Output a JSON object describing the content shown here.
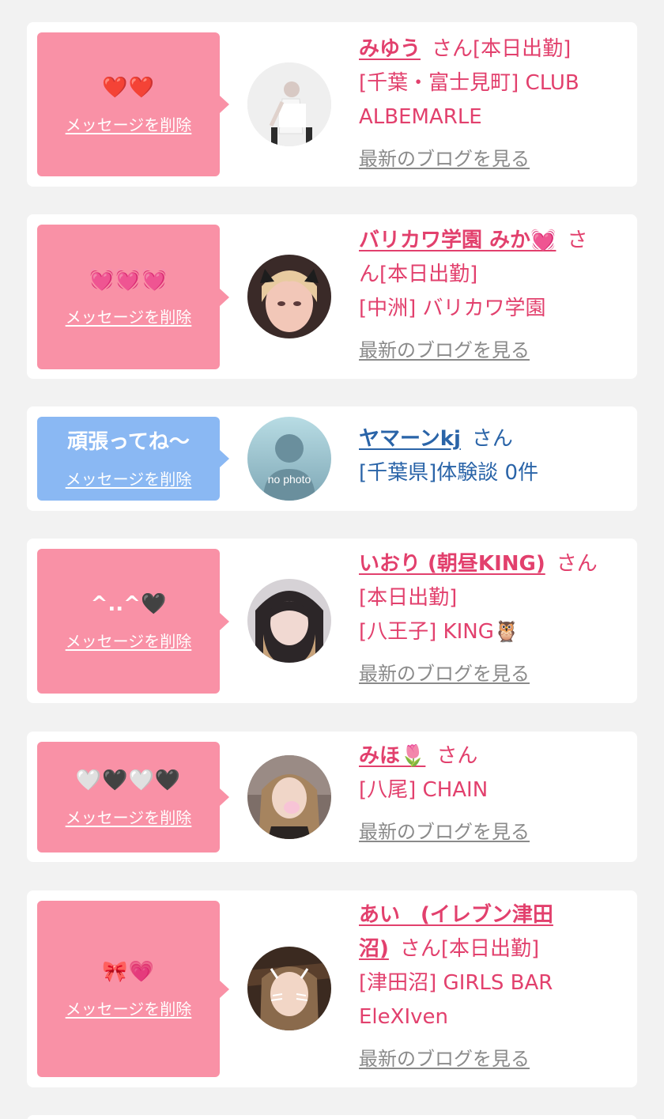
{
  "delete_label": "メッセージを削除",
  "blog_label": "最新のブログを見る",
  "honorific": "さん",
  "cards": [
    {
      "message": "❤️❤️",
      "name": "みゆう",
      "suffix": "さん[本日出勤]",
      "lines": [
        "[千葉・富士見町] CLUB",
        "ALBEMARLE"
      ]
    },
    {
      "message": "💓💓💓",
      "name": "バリカワ学園 みか💓",
      "suffix": "さ",
      "lines": [
        "ん[本日出勤]",
        "[中洲] バリカワ学園"
      ]
    },
    {
      "message": "頑張ってね〜",
      "name": "ヤマーンkj",
      "suffix": "さん",
      "lines": [
        "[千葉県]体験談 0件"
      ],
      "avatar_text": "no photo"
    },
    {
      "message": "^..^🖤",
      "name": "いおり (朝昼KING)",
      "suffix": "さん",
      "lines": [
        "[本日出勤]",
        "[八王子] KING🦉"
      ]
    },
    {
      "message": "🤍🖤🤍🖤",
      "name": "みほ🌷",
      "suffix": "さん",
      "lines": [
        "[八尾] CHAIN"
      ]
    },
    {
      "message": "🎀💗",
      "name_line1": "あい　(イレブン津田",
      "name_line2": "沼)",
      "suffix": "さん[本日出勤]",
      "lines": [
        "[津田沼] GIRLS BAR",
        "EleXIven"
      ]
    }
  ],
  "colors": {
    "pink_bubble": "#f991a6",
    "blue_bubble": "#8ab8f3",
    "pink_text": "#e2406d",
    "blue_text": "#2a64a8",
    "link_gray": "#8a8a8a"
  }
}
